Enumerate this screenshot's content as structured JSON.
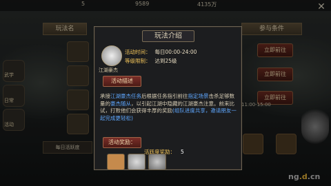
{
  "background": {
    "top_resources": [
      "5",
      "9589",
      "4135万"
    ],
    "list_header": {
      "col1": "玩法名",
      "col_right": "参与条件"
    },
    "left_nav": [
      "武学",
      "日常",
      "活动"
    ],
    "join_button_label": "立即前往",
    "row_time": "11:00-15:00",
    "bottom_label": "每日活跃度"
  },
  "modal": {
    "title": "玩法介绍",
    "avatar_label": "江湖豪杰",
    "activity_time_label": "活动时间：",
    "activity_time_value": "每日00:00-24:00",
    "level_limit_label": "等级限制：",
    "level_limit_value": "达到25级",
    "desc_button": "活动描述",
    "description_parts": [
      "承接",
      "江湖豪杰任务",
      "后根据任务指引前往",
      "指定场景",
      "击杀足够数量的",
      "豪杰随从",
      "，以引起江湖中隐藏的江湖豪杰注意。前来比试，打败他们会获得丰厚的奖励",
      "(组队进度共享，邀请朋友一起完成更轻松)"
    ],
    "reward_label": "活动奖励：",
    "favor_label": "活跃度奖励：",
    "favor_value": "5"
  },
  "watermark": {
    "prefix": "ng",
    "mid": ".d",
    "suffix": ".cn"
  },
  "colors": {
    "accent_gold": "#f3c55a",
    "highlight_blue": "#5fa8ff",
    "button_red": "#6a2a20"
  }
}
